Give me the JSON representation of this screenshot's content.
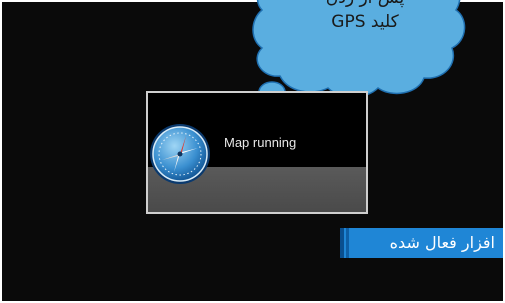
{
  "bubble": {
    "line1": "پس از زدن",
    "line2": "کلید GPS"
  },
  "popup": {
    "status_label": "Map running"
  },
  "caption": {
    "text": "افزار فعال شده"
  },
  "icons": {
    "compass": "compass-icon"
  },
  "colors": {
    "background": "#0a0a0a",
    "bubble_fill": "#5aaee0",
    "bubble_stroke": "#1f6fb0",
    "caption_fill": "#1f86d6",
    "popup_border": "#cfcfcf",
    "popup_lower": "#555555"
  }
}
